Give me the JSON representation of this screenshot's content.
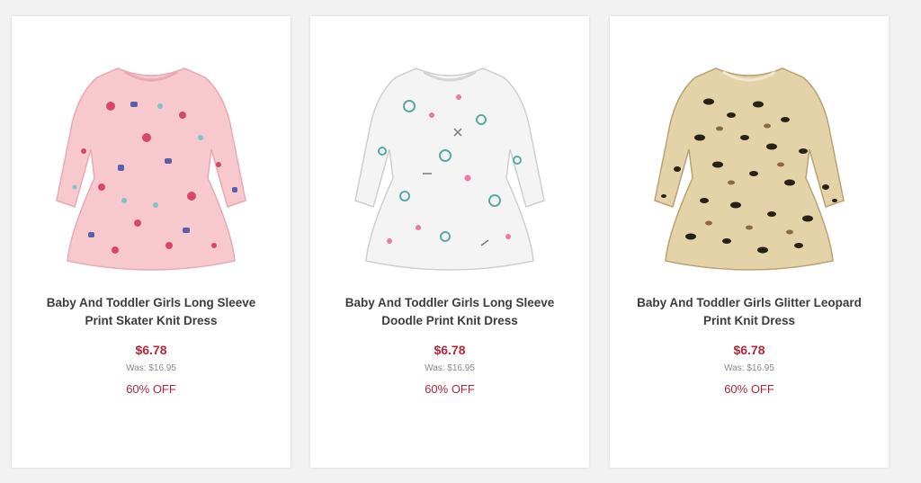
{
  "products": [
    {
      "title": "Baby And Toddler Girls Long Sleeve\nPrint Skater Knit Dress",
      "price": "$6.78",
      "was": "Was: $16.95",
      "discount": "60% OFF",
      "image_icon": "pink-print-dress-image",
      "colors": {
        "base": "#f7c9cf",
        "accent": "#d6486b",
        "accent2": "#5a5fa8"
      }
    },
    {
      "title": "Baby And Toddler Girls Long Sleeve\nDoodle Print Knit Dress",
      "price": "$6.78",
      "was": "Was: $16.95",
      "discount": "60% OFF",
      "image_icon": "white-doodle-dress-image",
      "colors": {
        "base": "#f4f4f4",
        "accent": "#5aa9a3",
        "accent2": "#e87aa8"
      }
    },
    {
      "title": "Baby And Toddler Girls Glitter Leopard\nPrint Knit Dress",
      "price": "$6.78",
      "was": "Was: $16.95",
      "discount": "60% OFF",
      "image_icon": "leopard-print-dress-image",
      "colors": {
        "base": "#e4d2a9",
        "accent": "#2a2116",
        "accent2": "#8c6a3f"
      }
    }
  ]
}
